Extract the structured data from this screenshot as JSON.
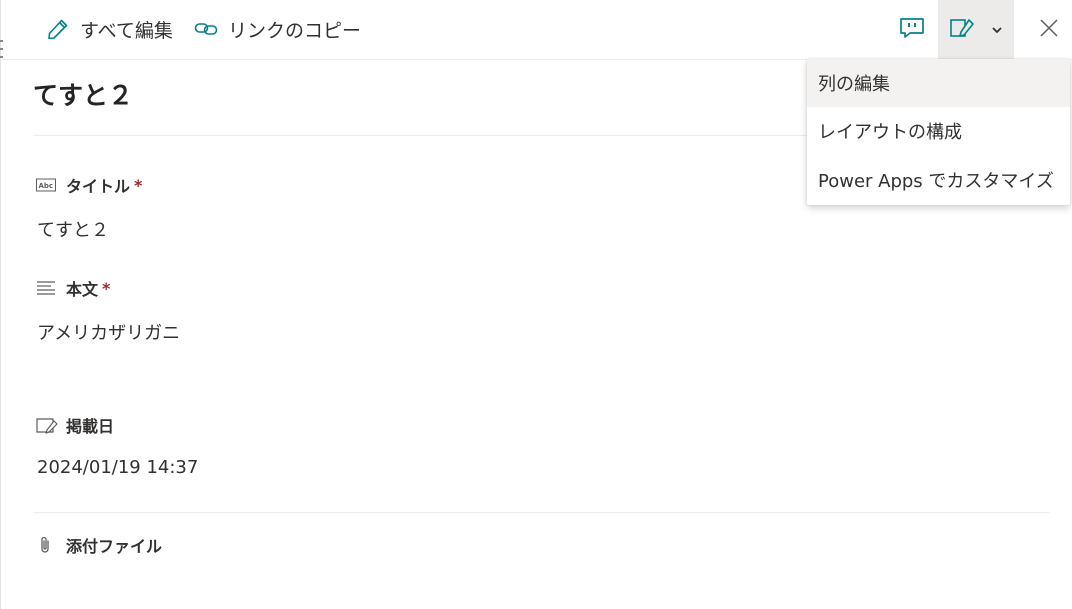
{
  "toolbar": {
    "edit_all_label": "すべて編集",
    "copy_link_label": "リンクのコピー"
  },
  "icons": {
    "edit": "pencil-icon",
    "link": "link-icon",
    "comment": "comment-icon",
    "form": "edit-form-icon",
    "chevron": "chevron-down-icon",
    "close": "close-icon"
  },
  "item": {
    "title": "てすと２"
  },
  "fields": [
    {
      "label": "タイトル",
      "required": "*",
      "value": "てすと２",
      "icon": "text-field-icon"
    },
    {
      "label": "本文",
      "required": "*",
      "value": "アメリカザリガニ",
      "icon": "multiline-text-icon"
    },
    {
      "label": "掲載日",
      "value": "2024/01/19 14:37",
      "icon": "date-field-icon"
    },
    {
      "label": "添付ファイル",
      "icon": "paperclip-icon"
    }
  ],
  "menu": {
    "items": [
      {
        "label": "列の編集"
      },
      {
        "label": "レイアウトの構成"
      },
      {
        "label": "Power Apps でカスタマイズ"
      }
    ]
  },
  "colors": {
    "accent": "#038387",
    "required": "#a4262c",
    "hover_bg": "#edebe9"
  }
}
